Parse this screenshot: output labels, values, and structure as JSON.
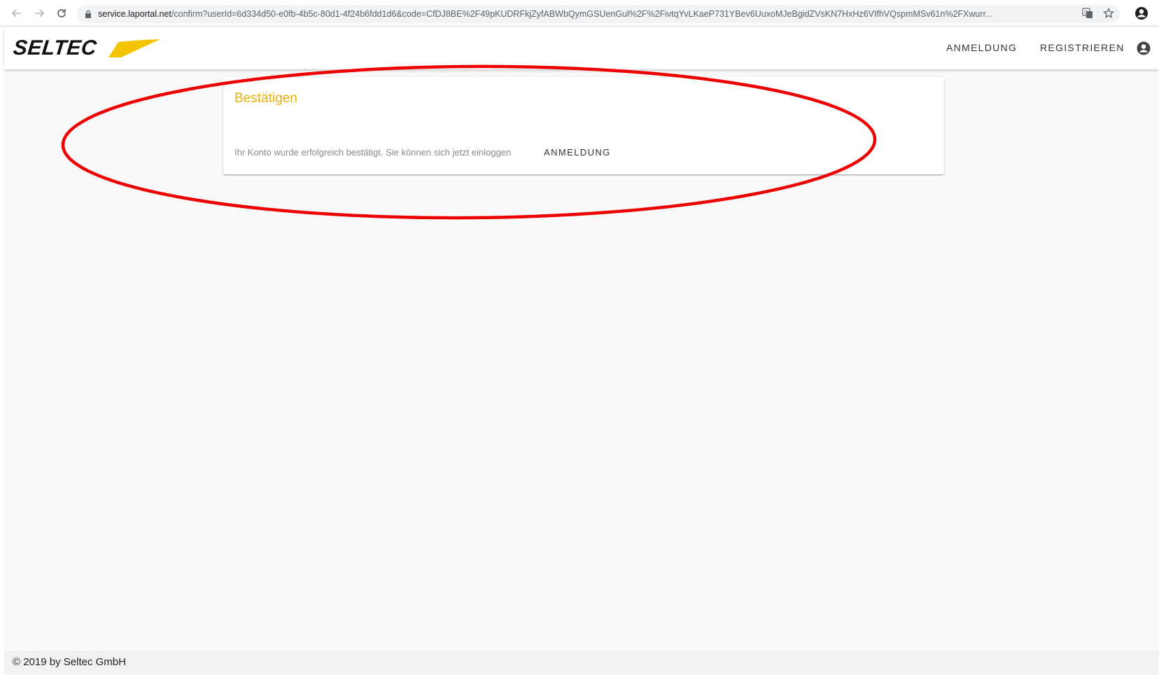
{
  "browser": {
    "url_host": "service.laportal.net",
    "url_path": "/confirm?userId=6d334d50-e0fb-4b5c-80d1-4f24b6fdd1d6&code=CfDJ8BE%2F49pKUDRFkjZyfABWbQymGSUenGul%2F%2FivtqYvLKaeP731YBev6UuxoMJeBgidZVsKN7HxHz6VIfhVQspmMSv61n%2FXwurr..."
  },
  "header": {
    "logo_text": "SELTEC",
    "login_label": "ANMELDUNG",
    "register_label": "REGISTRIEREN"
  },
  "card": {
    "title": "Bestätigen",
    "message": "Ihr Konto wurde erfolgreich bestätigt. Sie können sich jetzt einloggen",
    "login_button": "ANMELDUNG"
  },
  "footer": {
    "copyright": "© 2019 by Seltec GmbH"
  },
  "colors": {
    "accent": "#e8b10a",
    "logo_yellow": "#f5c400",
    "annotation_red": "#ee0000"
  },
  "icons": [
    "back-arrow-icon",
    "forward-arrow-icon",
    "reload-icon",
    "lock-icon",
    "translate-icon",
    "star-icon",
    "account-circle-icon"
  ]
}
